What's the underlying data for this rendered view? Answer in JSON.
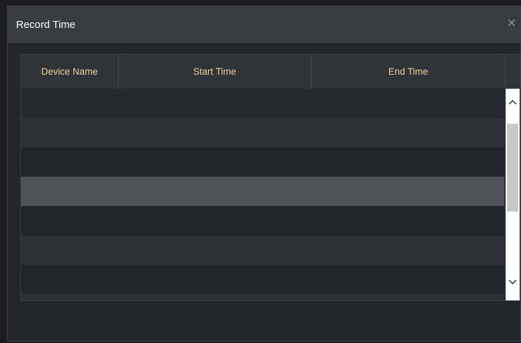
{
  "dialog": {
    "title": "Record Time",
    "close_glyph": "×"
  },
  "table": {
    "columns": [
      "Device Name",
      "Start Time",
      "End Time"
    ],
    "rows": [],
    "selected_row": 3
  },
  "scrollbar": {
    "up_glyph": "^",
    "down_glyph": "v"
  }
}
